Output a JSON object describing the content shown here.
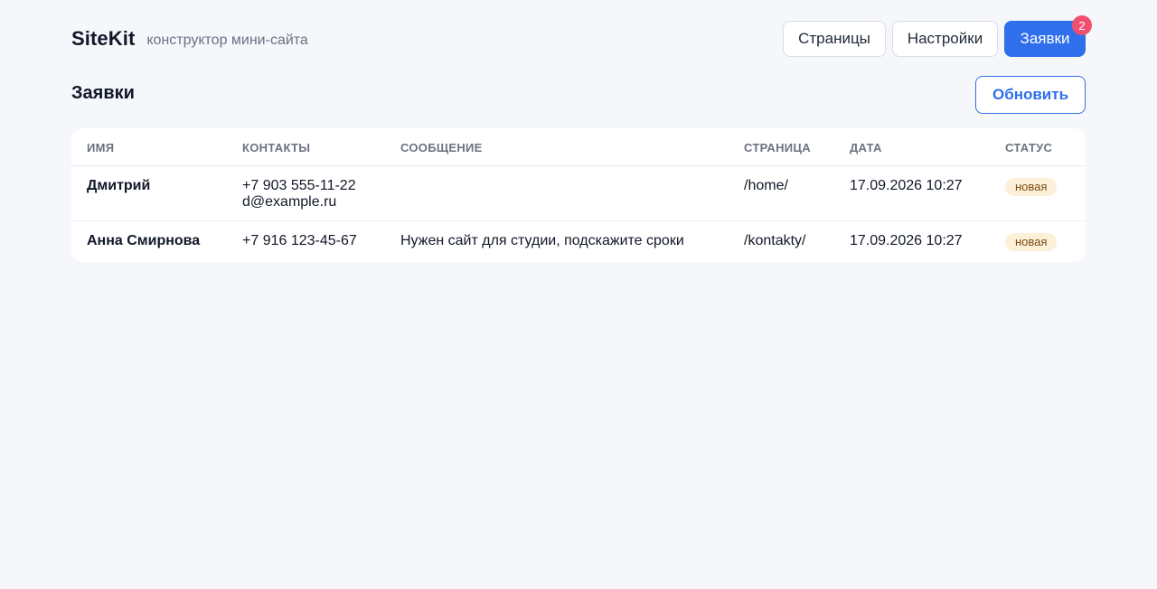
{
  "brand": {
    "name": "SiteKit",
    "subtitle": "конструктор мини-сайта"
  },
  "nav": {
    "pages_label": "Страницы",
    "settings_label": "Настройки",
    "requests_label": "Заявки",
    "requests_badge": "2",
    "active": "requests"
  },
  "page": {
    "title": "Заявки",
    "refresh_label": "Обновить"
  },
  "table": {
    "columns": [
      "ИМЯ",
      "КОНТАКТЫ",
      "СООБЩЕНИЕ",
      "СТРАНИЦА",
      "ДАТА",
      "СТАТУС"
    ],
    "rows": [
      {
        "name": "Дмитрий",
        "phone": "+7 903 555-11-22",
        "email": "d@example.ru",
        "message": "",
        "page": "/home/",
        "date": "17.09.2026 10:27",
        "status": "новая"
      },
      {
        "name": "Анна Смирнова",
        "phone": "+7 916 123-45-67",
        "email": "",
        "message": "Нужен сайт для студии, подскажите сроки",
        "page": "/kontakty/",
        "date": "17.09.2026 10:27",
        "status": "новая"
      }
    ]
  },
  "colors": {
    "accent": "#2f6fec",
    "badge": "#f0506e",
    "background": "#f5f7fb",
    "status_new_bg": "#fdf0d9",
    "status_new_text": "#7a4b12"
  }
}
